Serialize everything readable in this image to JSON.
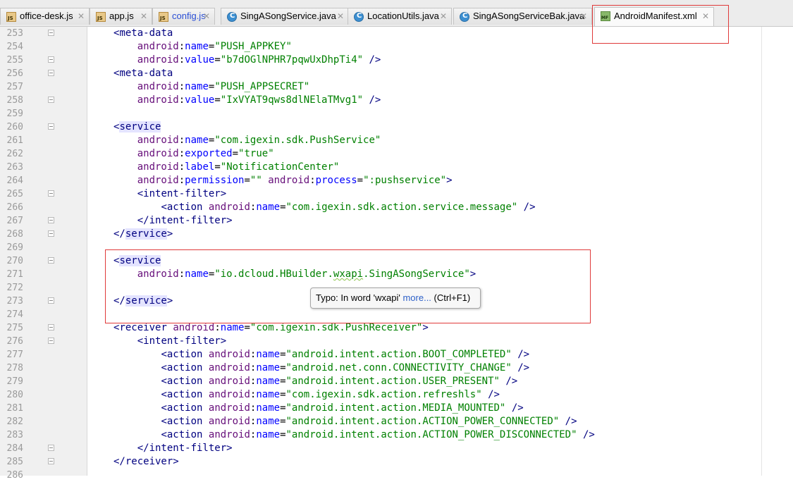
{
  "tabs": [
    {
      "label": "office-desk.js",
      "icon": "js-file-icon",
      "close": "✕"
    },
    {
      "label": "app.js",
      "icon": "js-file-icon",
      "close": "✕"
    },
    {
      "label": "config.js",
      "icon": "js-file-icon",
      "close": "✕"
    },
    {
      "label": "SingASongService.java",
      "icon": "java-class-icon",
      "close": "✕"
    },
    {
      "label": "LocationUtils.java",
      "icon": "java-class-icon",
      "close": "✕"
    },
    {
      "label": "SingASongServiceBak.java",
      "icon": "java-class-icon",
      "close": "✕"
    },
    {
      "label": "AndroidManifest.xml",
      "icon": "manifest-file-icon",
      "close": "✕",
      "active": true
    }
  ],
  "colors": {
    "tag": "#000080",
    "namespace": "#660e7a",
    "attribute": "#0000ff",
    "string": "#008000",
    "line_number": "#9a9a9a",
    "highlight_box": "#e03a3a"
  },
  "editor": {
    "lines": [
      {
        "n": "253",
        "text": "<meta-data"
      },
      {
        "n": "254",
        "text": "    android:name=\"PUSH_APPKEY\""
      },
      {
        "n": "255",
        "text": "    android:value=\"b7dOGlNPHR7pqwUxDhpTi4\" />"
      },
      {
        "n": "256",
        "text": "<meta-data"
      },
      {
        "n": "257",
        "text": "    android:name=\"PUSH_APPSECRET\""
      },
      {
        "n": "258",
        "text": "    android:value=\"IxVYAT9qws8dlNElaTMvg1\" />"
      },
      {
        "n": "259",
        "text": ""
      },
      {
        "n": "260",
        "text": "<service"
      },
      {
        "n": "261",
        "text": "    android:name=\"com.igexin.sdk.PushService\""
      },
      {
        "n": "262",
        "text": "    android:exported=\"true\""
      },
      {
        "n": "263",
        "text": "    android:label=\"NotificationCenter\""
      },
      {
        "n": "264",
        "text": "    android:permission=\"\" android:process=\":pushservice\">"
      },
      {
        "n": "265",
        "text": "    <intent-filter>"
      },
      {
        "n": "266",
        "text": "        <action android:name=\"com.igexin.sdk.action.service.message\" />"
      },
      {
        "n": "267",
        "text": "    </intent-filter>"
      },
      {
        "n": "268",
        "text": "</service>"
      },
      {
        "n": "269",
        "text": ""
      },
      {
        "n": "270",
        "text": "<service"
      },
      {
        "n": "271",
        "text": "    android:name=\"io.dcloud.HBuilder.wxapi.SingASongService\">"
      },
      {
        "n": "272",
        "text": ""
      },
      {
        "n": "273",
        "text": "</service>"
      },
      {
        "n": "274",
        "text": ""
      },
      {
        "n": "275",
        "text": "<receiver android:name=\"com.igexin.sdk.PushReceiver\">"
      },
      {
        "n": "276",
        "text": "    <intent-filter>"
      },
      {
        "n": "277",
        "text": "        <action android:name=\"android.intent.action.BOOT_COMPLETED\" />"
      },
      {
        "n": "278",
        "text": "        <action android:name=\"android.net.conn.CONNECTIVITY_CHANGE\" />"
      },
      {
        "n": "279",
        "text": "        <action android:name=\"android.intent.action.USER_PRESENT\" />"
      },
      {
        "n": "280",
        "text": "        <action android:name=\"com.igexin.sdk.action.refreshls\" />"
      },
      {
        "n": "281",
        "text": "        <action android:name=\"android.intent.action.MEDIA_MOUNTED\" />"
      },
      {
        "n": "282",
        "text": "        <action android:name=\"android.intent.action.ACTION_POWER_CONNECTED\" />"
      },
      {
        "n": "283",
        "text": "        <action android:name=\"android.intent.action.ACTION_POWER_DISCONNECTED\" />"
      },
      {
        "n": "284",
        "text": "    </intent-filter>"
      },
      {
        "n": "285",
        "text": "</receiver>"
      },
      {
        "n": "286",
        "text": ""
      }
    ]
  },
  "tooltip": {
    "prefix": "Typo: In word 'wxapi' ",
    "link": "more...",
    "shortcut": " (Ctrl+F1)"
  }
}
